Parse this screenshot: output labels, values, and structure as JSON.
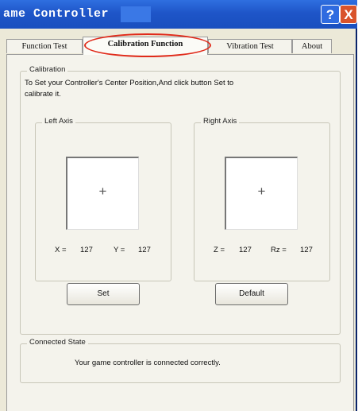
{
  "window": {
    "title": "ame Controller"
  },
  "titlebar_buttons": {
    "help": "?",
    "close": "X"
  },
  "tabs": [
    {
      "label": "Function Test"
    },
    {
      "label": "Calibration Function"
    },
    {
      "label": "Vibration Test"
    },
    {
      "label": "About"
    }
  ],
  "calibration": {
    "legend": "Calibration",
    "instruction_line1": "To Set your Controller's  Center Position,And click button Set to",
    "instruction_line2": "calibrate it.",
    "left_axis": {
      "legend": "Left Axis",
      "crosshair": "+",
      "x_label": "X =",
      "x_value": "127",
      "y_label": "Y =",
      "y_value": "127"
    },
    "right_axis": {
      "legend": "Right Axis",
      "crosshair": "+",
      "z_label": "Z =",
      "z_value": "127",
      "rz_label": "Rz =",
      "rz_value": "127"
    },
    "set_label": "Set",
    "default_label": "Default"
  },
  "connected": {
    "legend": "Connected State",
    "message": "Your game controller is connected correctly."
  },
  "colors": {
    "title_bar": "#1e55c8",
    "highlight_oval": "#e02a1a",
    "close_button": "#d9532b"
  }
}
